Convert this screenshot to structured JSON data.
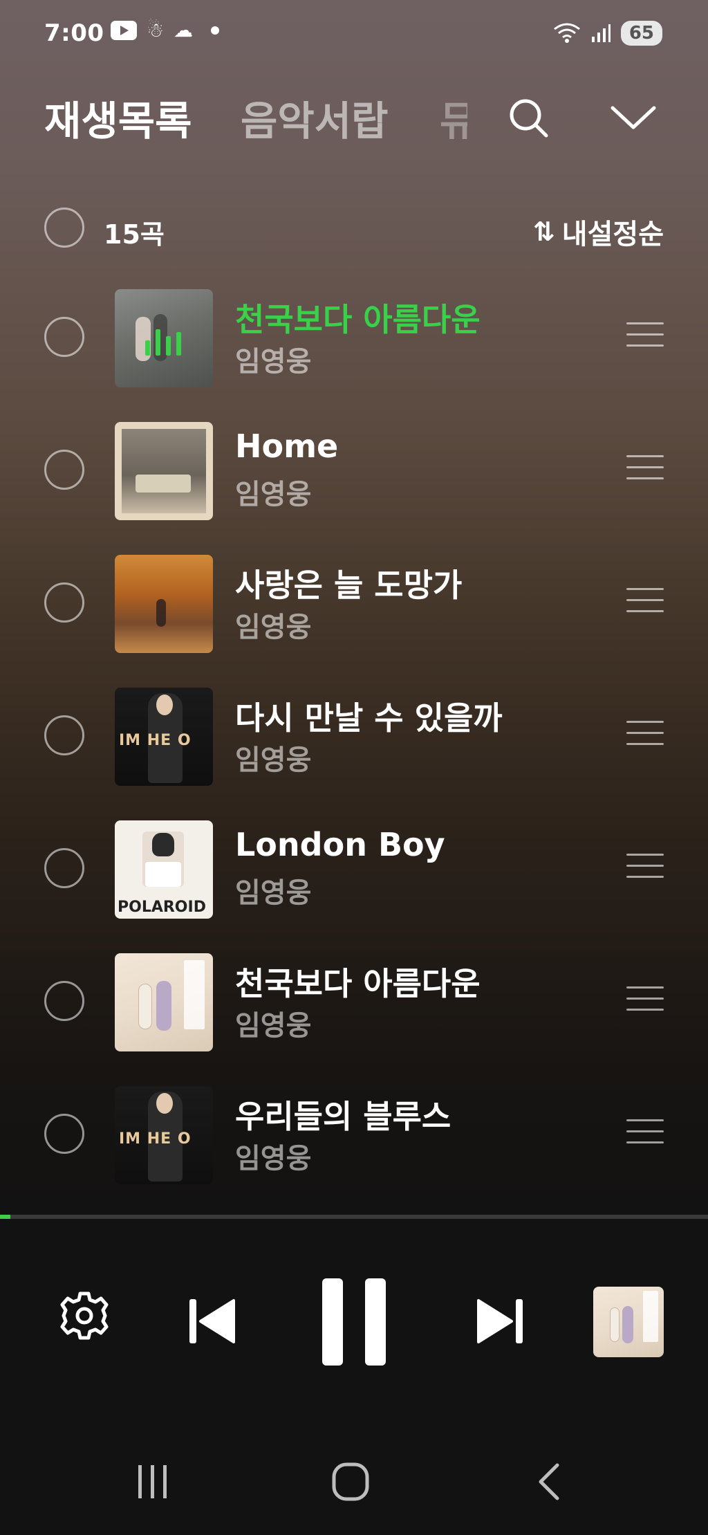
{
  "status_bar": {
    "time": "7:00",
    "battery": "65"
  },
  "header": {
    "tabs": [
      "재생목록",
      "음악서랍",
      "뮤"
    ],
    "search_icon": "search-icon",
    "collapse_icon": "chevron-down-icon"
  },
  "list": {
    "count_label": "15곡",
    "sort_label": "내설정순"
  },
  "songs": [
    {
      "title": "천국보다 아름다운",
      "artist": "임영웅",
      "playing": true
    },
    {
      "title": "Home",
      "artist": "임영웅",
      "playing": false
    },
    {
      "title": "사랑은 늘 도망가",
      "artist": "임영웅",
      "playing": false
    },
    {
      "title": "다시 만날 수 있을까",
      "artist": "임영웅",
      "playing": false
    },
    {
      "title": "London Boy",
      "artist": "임영웅",
      "playing": false
    },
    {
      "title": "천국보다 아름다운",
      "artist": "임영웅",
      "playing": false
    },
    {
      "title": "우리들의 블루스",
      "artist": "임영웅",
      "playing": false
    }
  ],
  "album_art_text": {
    "im_hero": "IM HE O",
    "polaroid": "POLAROID"
  },
  "player": {
    "progress_fraction": 0.015,
    "state": "playing"
  },
  "colors": {
    "accent_green": "#3ad04a",
    "player_background": "#121212"
  }
}
